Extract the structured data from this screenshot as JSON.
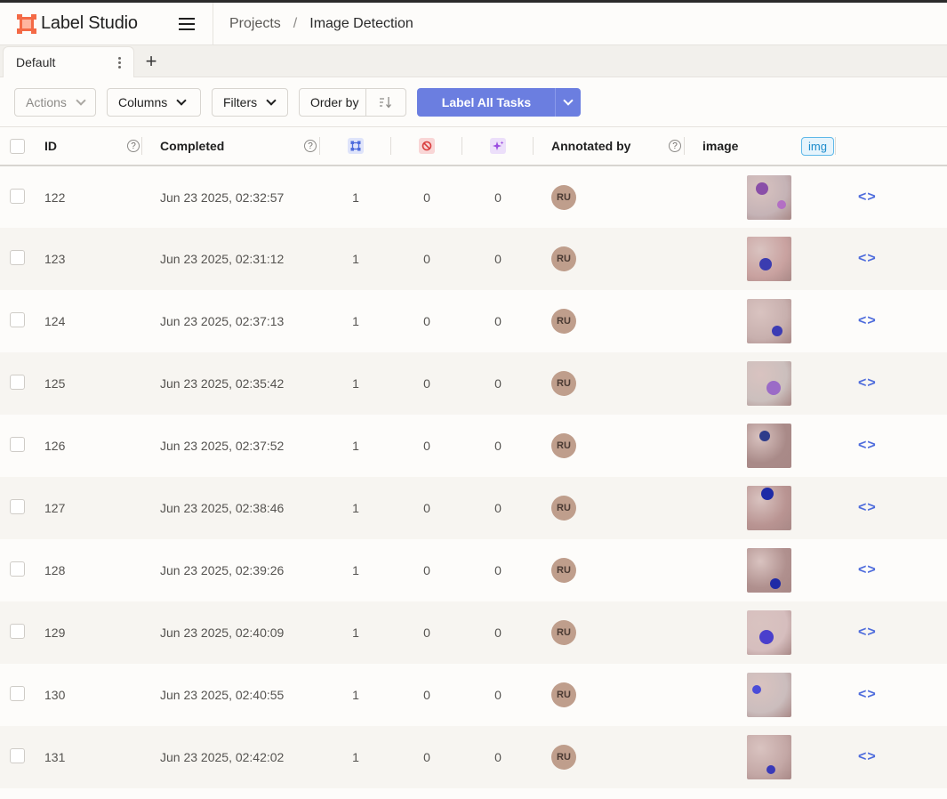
{
  "app": {
    "name": "Label Studio"
  },
  "breadcrumb": {
    "projects": "Projects",
    "separator": "/",
    "current": "Image Detection"
  },
  "tabs": [
    {
      "label": "Default"
    }
  ],
  "toolbar": {
    "actions": "Actions",
    "columns": "Columns",
    "filters": "Filters",
    "order_by": "Order by",
    "label_all": "Label All Tasks"
  },
  "columns": {
    "id": "ID",
    "completed": "Completed",
    "annotated_by": "Annotated by",
    "image": "image",
    "image_type": "img",
    "help": "?",
    "total_icon": "annotations-icon",
    "cancelled_icon": "cancelled-icon",
    "predictions_icon": "predictions-icon"
  },
  "rows": [
    {
      "id": "122",
      "completed": "Jun 23 2025, 02:32:57",
      "annotations": "1",
      "cancelled": "0",
      "predictions": "0",
      "annotator": "RU"
    },
    {
      "id": "123",
      "completed": "Jun 23 2025, 02:31:12",
      "annotations": "1",
      "cancelled": "0",
      "predictions": "0",
      "annotator": "RU"
    },
    {
      "id": "124",
      "completed": "Jun 23 2025, 02:37:13",
      "annotations": "1",
      "cancelled": "0",
      "predictions": "0",
      "annotator": "RU"
    },
    {
      "id": "125",
      "completed": "Jun 23 2025, 02:35:42",
      "annotations": "1",
      "cancelled": "0",
      "predictions": "0",
      "annotator": "RU"
    },
    {
      "id": "126",
      "completed": "Jun 23 2025, 02:37:52",
      "annotations": "1",
      "cancelled": "0",
      "predictions": "0",
      "annotator": "RU"
    },
    {
      "id": "127",
      "completed": "Jun 23 2025, 02:38:46",
      "annotations": "1",
      "cancelled": "0",
      "predictions": "0",
      "annotator": "RU"
    },
    {
      "id": "128",
      "completed": "Jun 23 2025, 02:39:26",
      "annotations": "1",
      "cancelled": "0",
      "predictions": "0",
      "annotator": "RU"
    },
    {
      "id": "129",
      "completed": "Jun 23 2025, 02:40:09",
      "annotations": "1",
      "cancelled": "0",
      "predictions": "0",
      "annotator": "RU"
    },
    {
      "id": "130",
      "completed": "Jun 23 2025, 02:40:55",
      "annotations": "1",
      "cancelled": "0",
      "predictions": "0",
      "annotator": "RU"
    },
    {
      "id": "131",
      "completed": "Jun 23 2025, 02:42:02",
      "annotations": "1",
      "cancelled": "0",
      "predictions": "0",
      "annotator": "RU"
    }
  ],
  "code_icon_text": "<>",
  "colors": {
    "brand": "#f46a46",
    "primary": "#6b7ee0",
    "link": "#4d6bdc",
    "avatar": "#bf9e8c"
  }
}
